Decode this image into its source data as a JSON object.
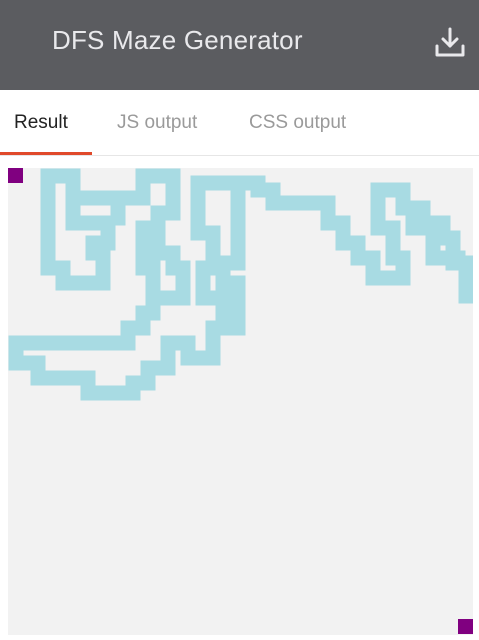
{
  "app": {
    "title": "DFS Maze Generator"
  },
  "toolbar": {
    "download_icon": "download-icon"
  },
  "tabs": [
    {
      "label": "Result",
      "active": true
    },
    {
      "label": "JS output",
      "active": false
    },
    {
      "label": "CSS output",
      "active": false
    }
  ],
  "colors": {
    "header_bg": "#5b5c60",
    "title_text": "#e9e9ec",
    "active_tab_underline": "#e0492b",
    "maze_path": "#a8dbe3",
    "maze_background": "#f2f2f2",
    "endpoint": "#800080"
  },
  "maze": {
    "endpoints": [
      "start",
      "end"
    ]
  }
}
